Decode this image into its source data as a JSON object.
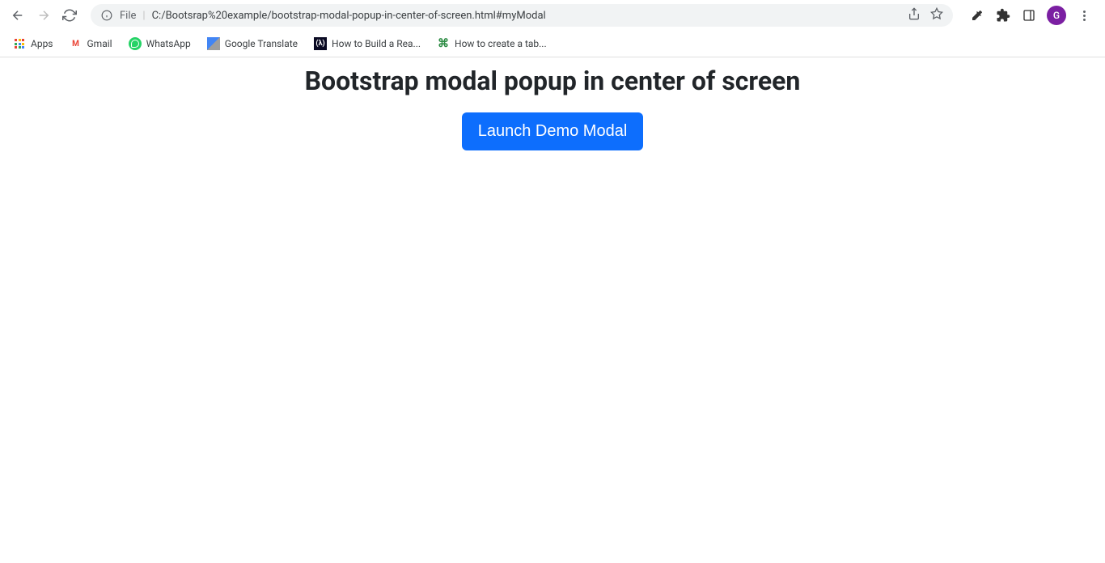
{
  "browser": {
    "address": {
      "file_label": "File",
      "url": "C:/Bootsrap%20example/bootstrap-modal-popup-in-center-of-screen.html#myModal"
    },
    "profile_initial": "G",
    "bookmarks": [
      {
        "label": "Apps",
        "icon": "apps"
      },
      {
        "label": "Gmail",
        "icon": "gmail"
      },
      {
        "label": "WhatsApp",
        "icon": "whatsapp"
      },
      {
        "label": "Google Translate",
        "icon": "translate"
      },
      {
        "label": "How to Build a Rea...",
        "icon": "freecodecamp"
      },
      {
        "label": "How to create a tab...",
        "icon": "gfg"
      }
    ]
  },
  "page": {
    "title": "Bootstrap modal popup in center of screen",
    "button_label": "Launch Demo Modal"
  }
}
